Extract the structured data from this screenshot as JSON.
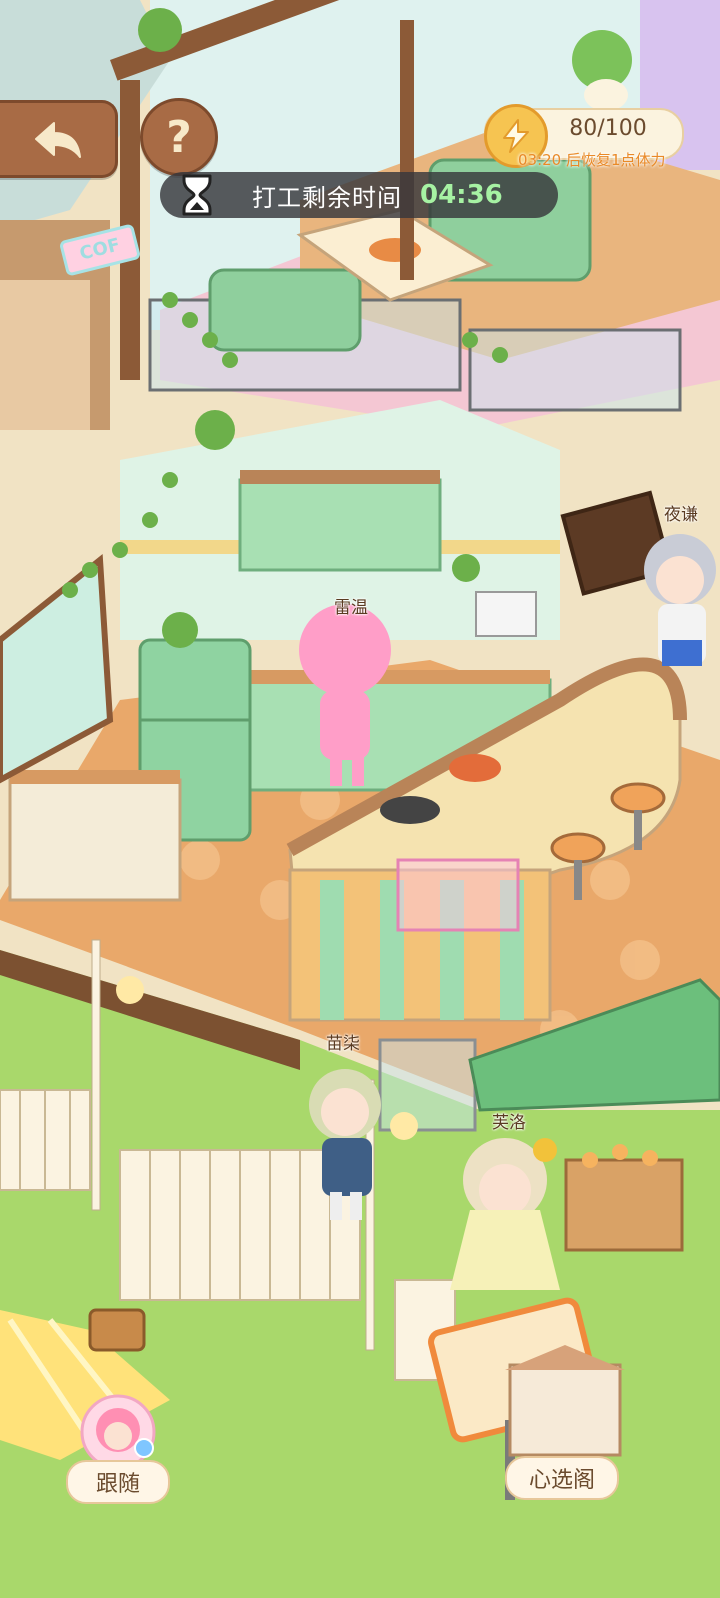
{
  "hud": {
    "stamina_value": "80/100",
    "stamina_note": "03:20 后恢复1点体力",
    "timer_label": "打工剩余时间",
    "timer_value": "04:36",
    "help_glyph": "?"
  },
  "characters": [
    {
      "name": "雷温"
    },
    {
      "name": "夜谦"
    },
    {
      "name": "苗柒"
    },
    {
      "name": "芙洛"
    }
  ],
  "signs": {
    "cafe_sign": "COF"
  },
  "bottom": {
    "follow_label": "跟随",
    "heart_label": "心选阁"
  },
  "colors": {
    "button_brown": "#a86b45",
    "timer_green": "#a6f2a3",
    "note_orange": "#e98a28",
    "grass": "#a9d86b",
    "floor": "#e9a86a"
  },
  "icons": {
    "back": "back-arrow-icon",
    "help": "question-icon",
    "timer": "hourglass-icon",
    "stamina": "lightning-icon"
  }
}
